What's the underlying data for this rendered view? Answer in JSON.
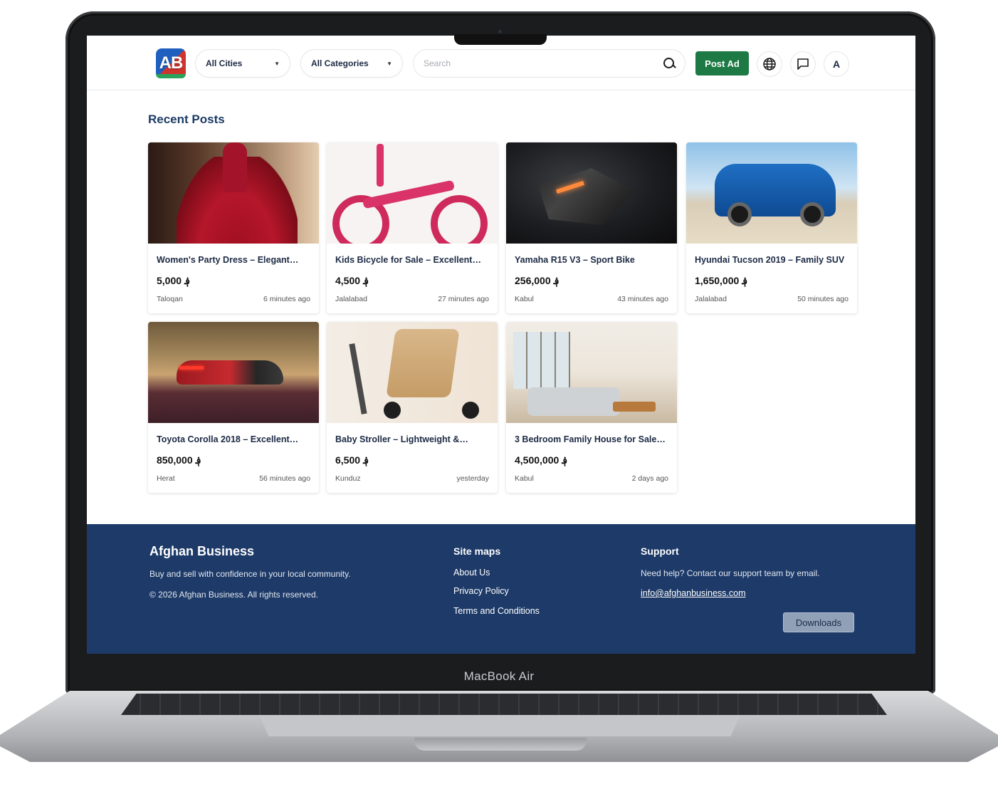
{
  "device": {
    "label": "MacBook Air"
  },
  "header": {
    "logo_text": "AB",
    "cities_select": "All Cities",
    "categories_select": "All Categories",
    "search_placeholder": "Search",
    "post_ad_label": "Post Ad",
    "avatar_initial": "A"
  },
  "main": {
    "section_title": "Recent Posts",
    "posts": [
      {
        "title": "Women's Party Dress – Elegant…",
        "price": "5,000 ؋",
        "city": "Taloqan",
        "time": "6 minutes ago"
      },
      {
        "title": "Kids Bicycle for Sale – Excellent…",
        "price": "4,500 ؋",
        "city": "Jalalabad",
        "time": "27 minutes ago"
      },
      {
        "title": "Yamaha R15 V3 – Sport Bike",
        "price": "256,000 ؋",
        "city": "Kabul",
        "time": "43 minutes ago"
      },
      {
        "title": "Hyundai Tucson 2019 – Family SUV",
        "price": "1,650,000 ؋",
        "city": "Jalalabad",
        "time": "50 minutes ago"
      },
      {
        "title": "Toyota Corolla 2018 – Excellent…",
        "price": "850,000 ؋",
        "city": "Herat",
        "time": "56 minutes ago"
      },
      {
        "title": "Baby Stroller – Lightweight &…",
        "price": "6,500 ؋",
        "city": "Kunduz",
        "time": "yesterday"
      },
      {
        "title": "3 Bedroom Family House for Sale…",
        "price": "4,500,000 ؋",
        "city": "Kabul",
        "time": "2 days ago"
      }
    ]
  },
  "footer": {
    "brand": "Afghan Business",
    "tagline": "Buy and sell with confidence in your local community.",
    "copyright": "© 2026 Afghan Business. All rights reserved.",
    "sitemaps_title": "Site maps",
    "links": [
      "About Us",
      "Privacy Policy",
      "Terms and Conditions"
    ],
    "support_title": "Support",
    "support_text": "Need help? Contact our support team by email.",
    "support_email": "info@afghanbusiness.com",
    "downloads_label": "Downloads"
  },
  "colors": {
    "brand_navy": "#1d3a68",
    "post_ad_green": "#1d7a44",
    "title_blue": "#1d3b66"
  }
}
